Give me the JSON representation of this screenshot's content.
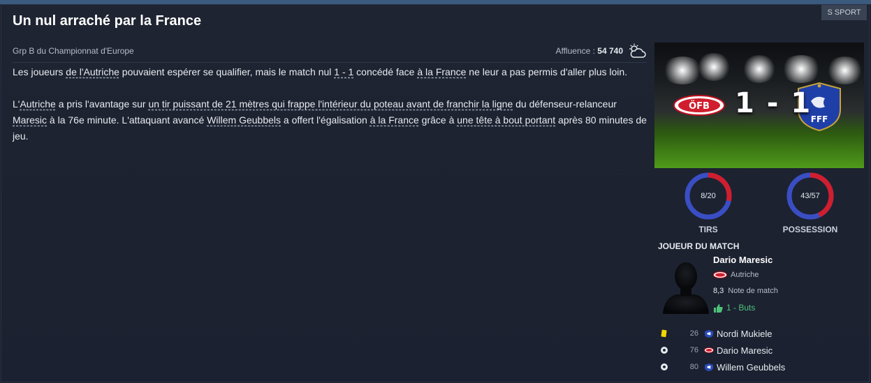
{
  "badge": "S SPORT",
  "headline": "Un nul arraché par la France",
  "subhead": "Grp B du Championnat d'Europe",
  "attendance": {
    "label": "Affluence :",
    "value": "54 740"
  },
  "weather_icon": "cloud-sun-icon",
  "article": {
    "p1": [
      {
        "t": "Les joueurs "
      },
      {
        "t": "de l'Autriche",
        "u": true
      },
      {
        "t": " pouvaient espérer se qualifier, mais le match nul "
      },
      {
        "t": "1 - 1",
        "u": true
      },
      {
        "t": " concédé face "
      },
      {
        "t": "à la France",
        "u": true
      },
      {
        "t": " ne leur a pas permis d'aller plus loin."
      }
    ],
    "p2": [
      {
        "t": "L'"
      },
      {
        "t": "Autriche",
        "u": true
      },
      {
        "t": " a pris l'avantage sur "
      },
      {
        "t": "un tir puissant de 21 mètres qui frappe l'intérieur du poteau avant de franchir la ligne",
        "u": true
      },
      {
        "t": " du défenseur-relanceur "
      },
      {
        "t": "Maresic",
        "u": true
      },
      {
        "t": " à la 76e minute. L'attaquant avancé "
      },
      {
        "t": "Willem Geubbels",
        "u": true
      },
      {
        "t": " a offert l'égalisation "
      },
      {
        "t": "à la France",
        "u": true
      },
      {
        "t": " grâce à "
      },
      {
        "t": "une tête à bout portant",
        "u": true
      },
      {
        "t": " après 80 minutes de jeu."
      }
    ]
  },
  "score": {
    "home_score": "1",
    "separator": "-",
    "away_score": "1",
    "home_crest_text": "ÖFB",
    "away_crest_text": "FFF"
  },
  "stats": [
    {
      "label": "TIRS",
      "value": "8/20",
      "home": 8,
      "away": 20
    },
    {
      "label": "POSSESSION",
      "value": "43/57",
      "home": 43,
      "away": 57
    }
  ],
  "colors": {
    "home": "#d01e2e",
    "away": "#3a4ec4",
    "goal": "#4ec27a",
    "card": "#f2d600"
  },
  "motm": {
    "title": "JOUEUR DU MATCH",
    "name": "Dario Maresic",
    "team": "Autriche",
    "rating": "8,3",
    "rating_label": "Note de match",
    "goals": "1 - Buts"
  },
  "events": [
    {
      "icon": "yellow-card-icon",
      "minute": "26",
      "team": "france",
      "player": "Nordi Mukiele"
    },
    {
      "icon": "goal-ball-icon",
      "minute": "76",
      "team": "austria",
      "player": "Dario Maresic"
    },
    {
      "icon": "goal-ball-icon",
      "minute": "80",
      "team": "france",
      "player": "Willem Geubbels"
    }
  ]
}
